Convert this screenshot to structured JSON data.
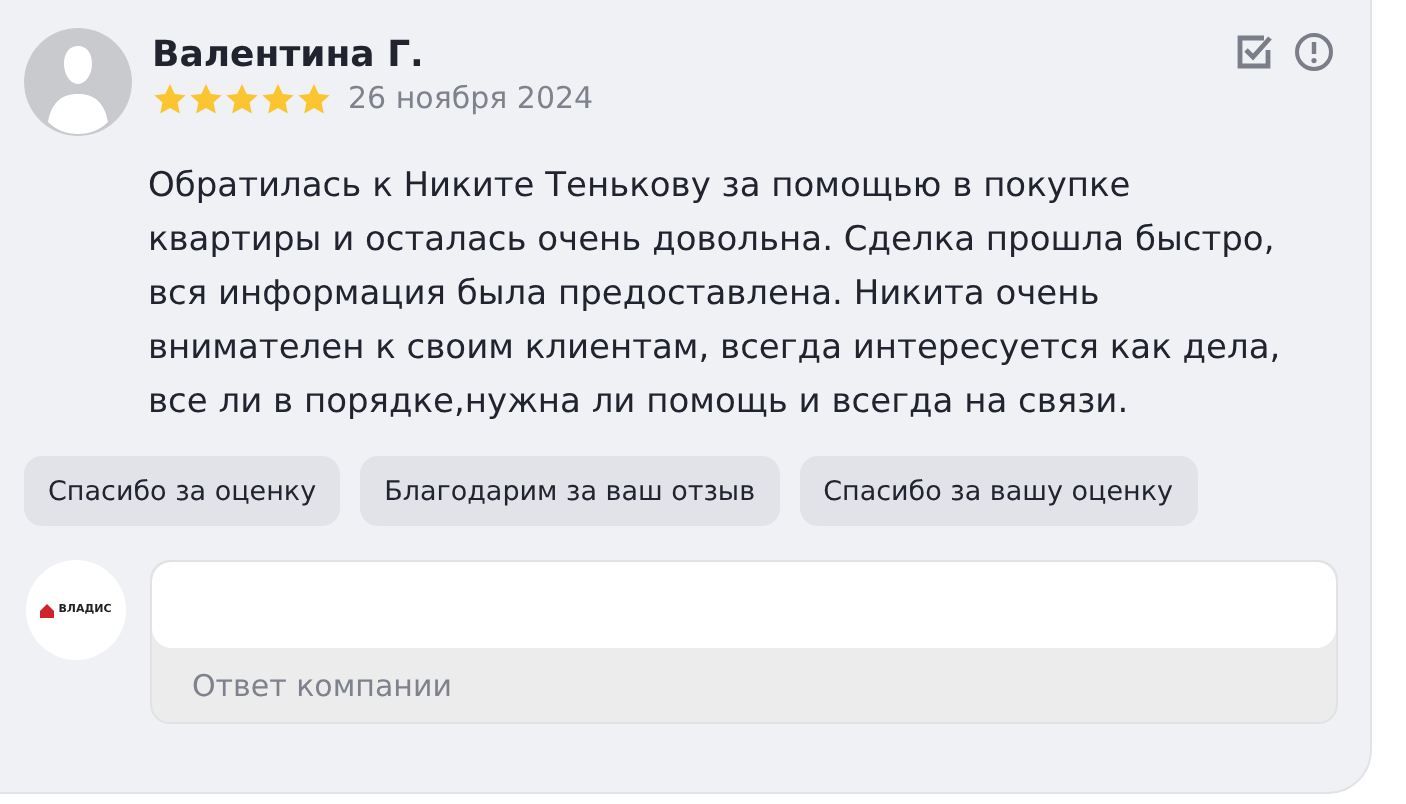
{
  "review": {
    "author": "Валентина Г.",
    "stars": 5,
    "date": "26 ноября 2024",
    "text": "Обратилась к Никите Тенькову за помощью в покупке квартиры и осталась очень довольна. Сделка прошла быстро, вся информация была предоставлена. Никита очень внимателен к своим клиентам, всегда интересуется как дела, все ли в порядке,нужна ли помощь и всегда на связи."
  },
  "quick_replies": [
    "Спасибо за оценку",
    "Благодарим за ваш отзыв",
    "Спасибо за вашу оценку"
  ],
  "company": {
    "logo_text": "ВЛАДИС"
  },
  "reply": {
    "label": "Ответ компании"
  }
}
